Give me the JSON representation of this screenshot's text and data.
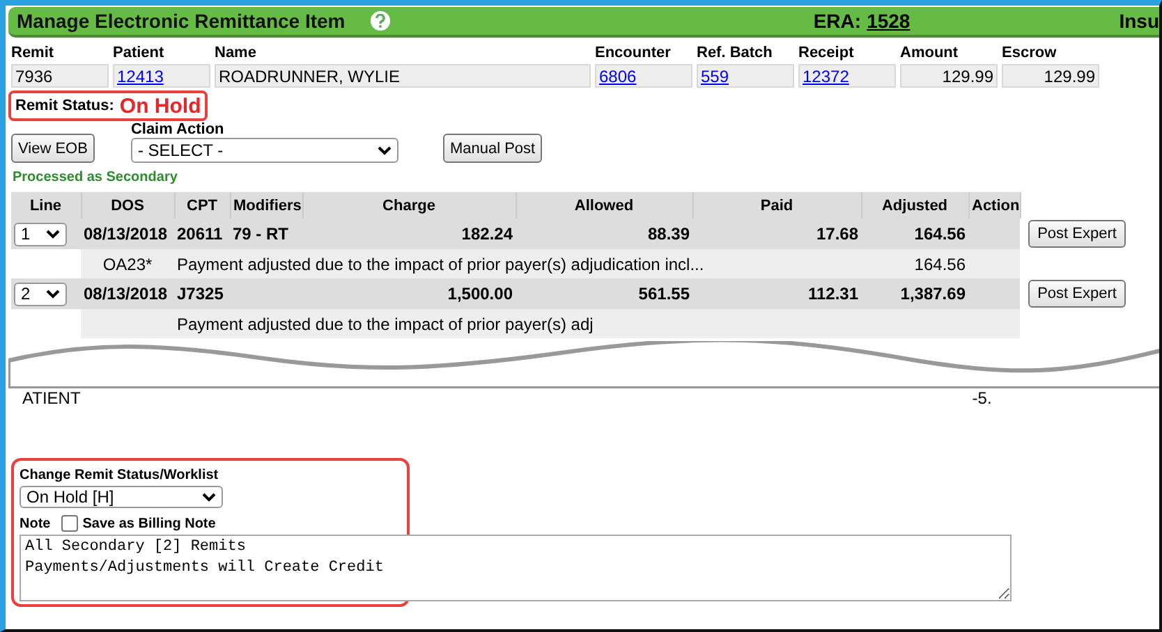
{
  "header": {
    "title": "Manage Electronic Remittance Item",
    "era_label": "ERA:",
    "era_number": "1528",
    "cut_text": "Insu"
  },
  "summary": [
    {
      "label": "Remit",
      "value": "7936",
      "kind": "plain"
    },
    {
      "label": "Patient",
      "value": "12413",
      "kind": "link"
    },
    {
      "label": "Name",
      "value": "ROADRUNNER, WYLIE",
      "kind": "plain"
    },
    {
      "label": "Encounter",
      "value": "6806",
      "kind": "link"
    },
    {
      "label": "Ref. Batch",
      "value": "559",
      "kind": "link"
    },
    {
      "label": "Receipt",
      "value": "12372",
      "kind": "link"
    },
    {
      "label": "Amount",
      "value": "129.99",
      "kind": "amount"
    },
    {
      "label": "Escrow",
      "value": "129.99",
      "kind": "amount"
    }
  ],
  "remit_status": {
    "label": "Remit Status:",
    "value": "On Hold"
  },
  "view_eob_button": "View EOB",
  "claim_action": {
    "label": "Claim Action",
    "value": "- SELECT -"
  },
  "manual_post_button": "Manual Post",
  "processed_note": "Processed as Secondary",
  "table": {
    "columns": [
      "Line",
      "DOS",
      "CPT",
      "Modifiers",
      "Charge",
      "Allowed",
      "Paid",
      "Adjusted",
      "Action"
    ],
    "lines": [
      {
        "line": "1",
        "dos": "08/13/2018",
        "cpt": "20611",
        "modifiers": "79 - RT",
        "charge": "182.24",
        "allowed": "88.39",
        "paid": "17.68",
        "adjusted": "164.56",
        "action": "Post Expert",
        "adjustments": [
          {
            "code": "OA23*",
            "description": "Payment adjusted due to the impact of prior payer(s) adjudication incl...",
            "adjusted": "164.56"
          }
        ]
      },
      {
        "line": "2",
        "dos": "08/13/2018",
        "cpt": "J7325",
        "charge": "1,500.00",
        "allowed": "561.55",
        "paid": "112.31",
        "adjusted": "1,387.69",
        "action": "Post Expert",
        "adjustments": [
          {
            "description": "Payment adjusted due to the impact of prior payer(s) adj"
          }
        ]
      }
    ]
  },
  "below_tear": {
    "fragments": [
      "ATIENT",
      "-5."
    ]
  },
  "worklist": {
    "label": "Change Remit Status/Worklist",
    "value": "On Hold [H]"
  },
  "note": {
    "label": "Note",
    "save_as_billing_note": {
      "label": "Save as Billing Note",
      "checked": false
    },
    "value": "All Secondary [2] Remits\nPayments/Adjustments will Create Credit"
  }
}
